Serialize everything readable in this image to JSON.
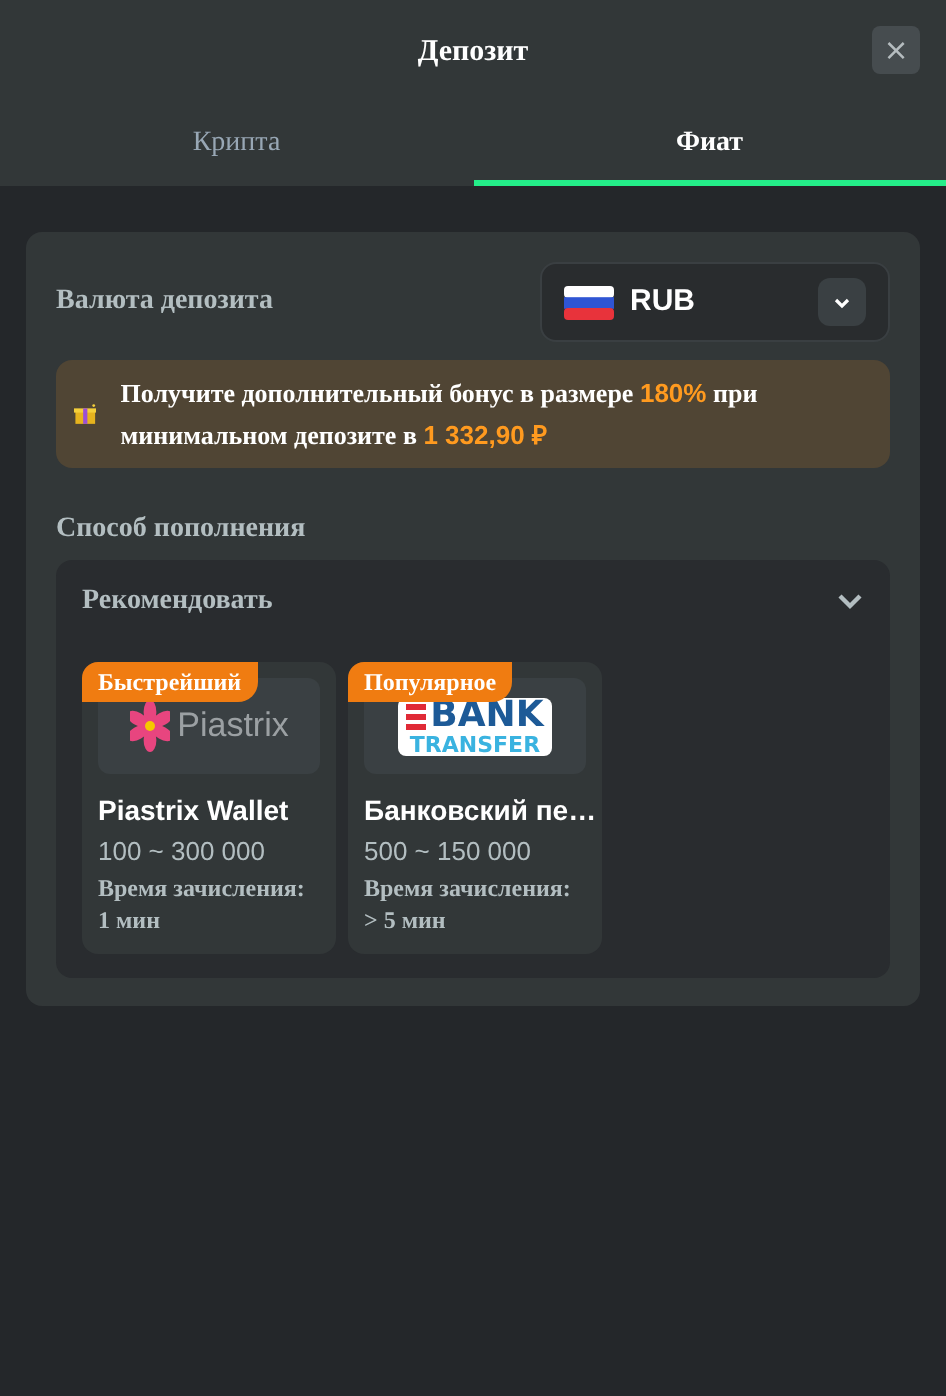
{
  "dialog": {
    "title": "Депозит",
    "close": "×"
  },
  "tabs": [
    {
      "label": "Крипта",
      "selected": false
    },
    {
      "label": "Фиат",
      "selected": true
    }
  ],
  "currency": {
    "label": "Валюта депозита",
    "value": "RUB",
    "expanded": false
  },
  "bonus": {
    "parts": [
      {
        "text": "Получите дополнительный бонус в размере ",
        "highlight": false
      },
      {
        "text": "180%",
        "highlight": true
      },
      {
        "text": " при минимальном депозите в ",
        "highlight": false
      },
      {
        "text": "1 332,90 ₽",
        "highlight": true
      }
    ]
  },
  "method": {
    "label": "Способ пополнения",
    "group": "Рекомендовать",
    "expanded": true,
    "items": [
      {
        "badge": "Быстрейший",
        "kind": "piastrix",
        "logo": [
          "Piastrix"
        ],
        "name": "Piastrix Wallet",
        "range": "100 ~ 300 000",
        "time_label": "Время зачисления:",
        "time": "1 мин"
      },
      {
        "badge": "Популярное",
        "kind": "bank",
        "logo": [
          "BANK",
          "TRANSFER"
        ],
        "name": "Банковский пе…",
        "range": "500 ~ 150 000",
        "time_label": "Время зачисления:",
        "time": "> 5 мин"
      }
    ]
  }
}
